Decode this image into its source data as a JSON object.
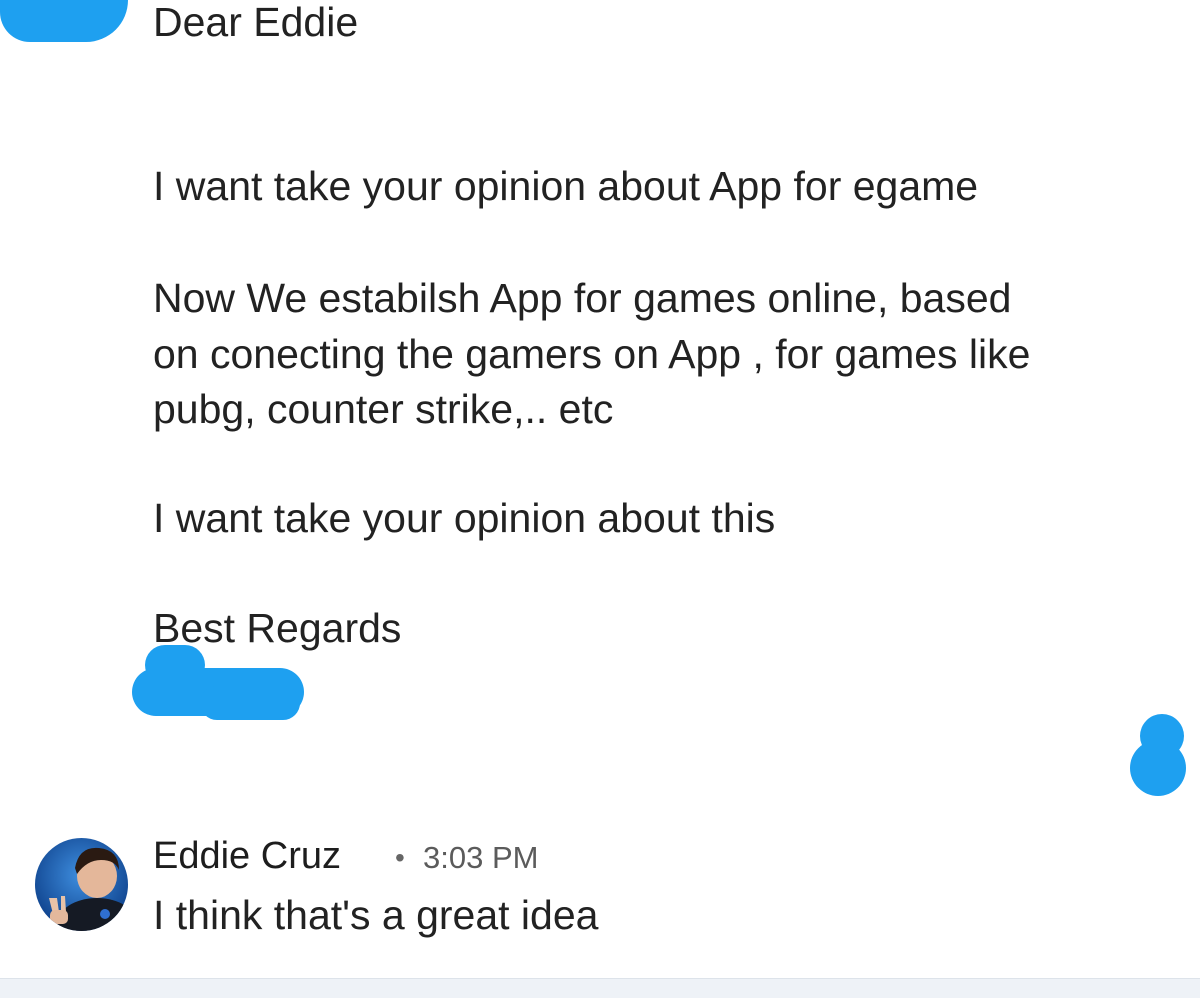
{
  "message": {
    "greeting": "Dear Eddie",
    "line1": "I want take your opinion about App for egame",
    "para2_line1": "Now We   estabilsh App for games online, based",
    "para2_line2": "on conecting the gamers on App , for games like",
    "para2_line3": "pubg, counter strike,.. etc",
    "line3": "I want take your opinion about this",
    "closing": "Best Regards"
  },
  "reply": {
    "sender": "Eddie Cruz",
    "separator": "•",
    "time": "3:03 PM",
    "text": "I think that's a great idea"
  },
  "colors": {
    "redaction": "#1ea0f0",
    "text": "#222222",
    "muted": "#5b5b5b"
  }
}
